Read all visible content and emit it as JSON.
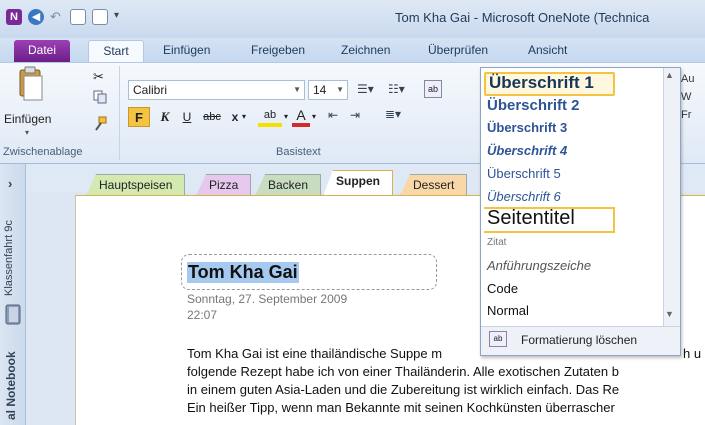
{
  "window": {
    "title": "Tom Kha Gai - Microsoft OneNote (Technica"
  },
  "tabs": [
    "Datei",
    "Start",
    "Einfügen",
    "Freigeben",
    "Zeichnen",
    "Überprüfen",
    "Ansicht"
  ],
  "ribbon": {
    "clipboard": {
      "paste_label": "Einfügen",
      "group_label": "Zwischenablage"
    },
    "basic_text": {
      "font_name": "Calibri",
      "font_size": "14",
      "group_label": "Basistext",
      "bold": "F",
      "italic": "K",
      "underline": "U",
      "strike": "abc",
      "subscript": "x",
      "highlight": "ab",
      "font_color": "A"
    },
    "styles": {
      "items": [
        "Überschrift 1",
        "Überschrift 2",
        "Überschrift 3",
        "Überschrift 4",
        "Überschrift 5",
        "Überschrift 6",
        "Seitentitel",
        "Zitat",
        "Anführungszeiche",
        "Code",
        "Normal"
      ],
      "selected": "Überschrift 1",
      "clear_formatting": "Formatierung löschen"
    },
    "right_clipped": [
      "Au",
      "W",
      "Fr"
    ]
  },
  "sidebar": {
    "section_label": "Klassenfahrt 9c",
    "notebook_label": "al Notebook"
  },
  "sections": [
    "Hauptspeisen",
    "Pizza",
    "Backen",
    "Suppen",
    "Dessert"
  ],
  "active_section": "Suppen",
  "page": {
    "title": "Tom Kha Gai",
    "date": "Sonntag, 27. September  2009",
    "time": "22:07",
    "body": [
      "Tom Kha Gai ist eine thailändische Suppe m",
      "folgende Rezept habe ich von einer Thailänderin. Alle exotischen Zutaten b",
      "in einem guten Asia-Laden und die Zubereitung ist wirklich einfach. Das Re",
      "Ein heißer Tipp, wenn man Bekannte mit seinen Kochkünsten überrascher"
    ],
    "body_clipped_right": "h u"
  },
  "colors": {
    "datei_tab": "#7a2a96",
    "heading_blue": "#17365d",
    "selection_blue": "#a6c9f0",
    "gallery_highlight": "#f5c342"
  }
}
